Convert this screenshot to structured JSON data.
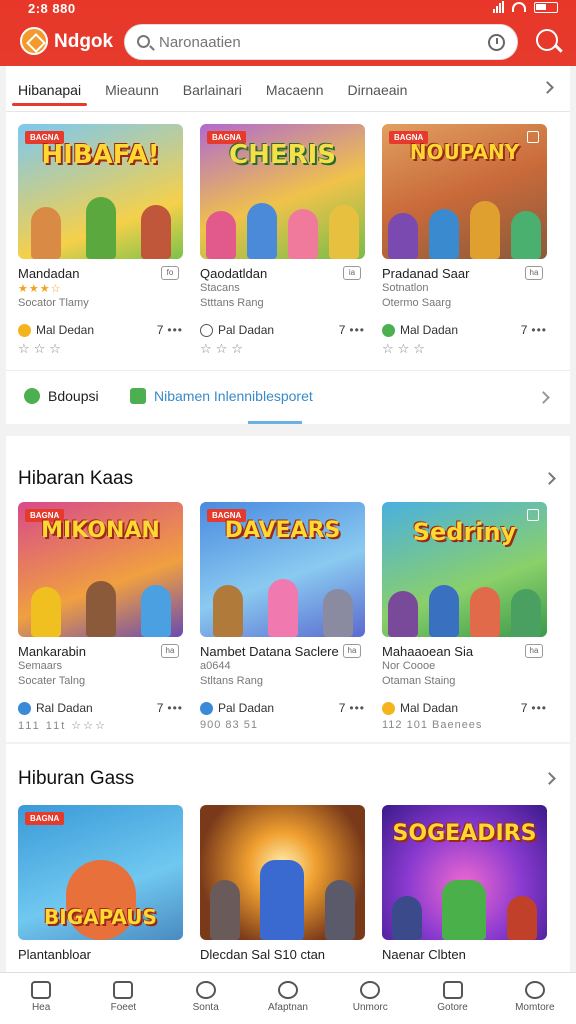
{
  "status": {
    "time": "2:8 880"
  },
  "header": {
    "brand": "Ndgok",
    "search_placeholder": "Naronaatien"
  },
  "tabs": [
    "Hibanapai",
    "Mieaunn",
    "Barlainari",
    "Macaenn",
    "Dirnaeain"
  ],
  "section1": {
    "cards": [
      {
        "badge": "BAGNA",
        "art": "HIBAFA!",
        "name": "Mandadan",
        "tag": "fo",
        "stars": "★★★☆",
        "sub": "Socator Tlamy",
        "author": "Mal Dedan",
        "count": "7",
        "rating": "☆☆☆"
      },
      {
        "badge": "BAGNA",
        "art": "CHERIS",
        "name": "Qaodatldan",
        "tag": "ia",
        "stars": "Stacans",
        "sub": "Stttans Rang",
        "author": "Pal Dadan",
        "count": "7",
        "rating": "☆☆☆"
      },
      {
        "badge": "BAGNA",
        "art": "NOUPANY",
        "name": "Pradanad Saar",
        "tag": "ha",
        "stars": "Sotnatlon",
        "sub": "Otermo Saarg",
        "author": "Mal Dadan",
        "count": "7",
        "rating": "☆☆☆"
      }
    ]
  },
  "promo": {
    "left": "Bdoupsi",
    "right": "Nibamen Inlenniblesporet"
  },
  "section2": {
    "title": "Hibaran Kaas",
    "cards": [
      {
        "badge": "BAGNA",
        "art": "MIKONAN",
        "name": "Mankarabin",
        "tag": "ha",
        "stars": "Semaars",
        "sub": "Socater Talng",
        "author": "Ral Dadan",
        "count": "7",
        "rating": "111 11t ☆☆☆"
      },
      {
        "badge": "BAGNA",
        "art": "DAVEARS",
        "name": "Nambet Datana Saclere",
        "tag": "ha",
        "stars": "a0644",
        "sub": "Stltans Rang",
        "author": "Pal Dadan",
        "count": "7",
        "rating": "900 83 51"
      },
      {
        "badge": "",
        "art": "Sedriny",
        "name": "Mahaaoean Sia",
        "tag": "ha",
        "stars": "Nor Coooe",
        "sub": "Otaman Staing",
        "author": "Mal Dadan",
        "count": "7",
        "rating": "112 101 Baenees"
      }
    ]
  },
  "section3": {
    "title": "Hiburan Gass",
    "cards": [
      {
        "badge": "BAGNA",
        "art": "BIGAPAUS",
        "name": "Plantanbloar"
      },
      {
        "badge": "",
        "art": "",
        "name": "Dlecdan Sal S10 ctan"
      },
      {
        "badge": "",
        "art": "SOGEADIRS",
        "name": "Naenar Clbten"
      }
    ]
  },
  "bottom_nav": [
    "Hea",
    "Foeet",
    "Sonta",
    "Afaptnan",
    "Unmorc",
    "Gotore",
    "Momtore"
  ]
}
